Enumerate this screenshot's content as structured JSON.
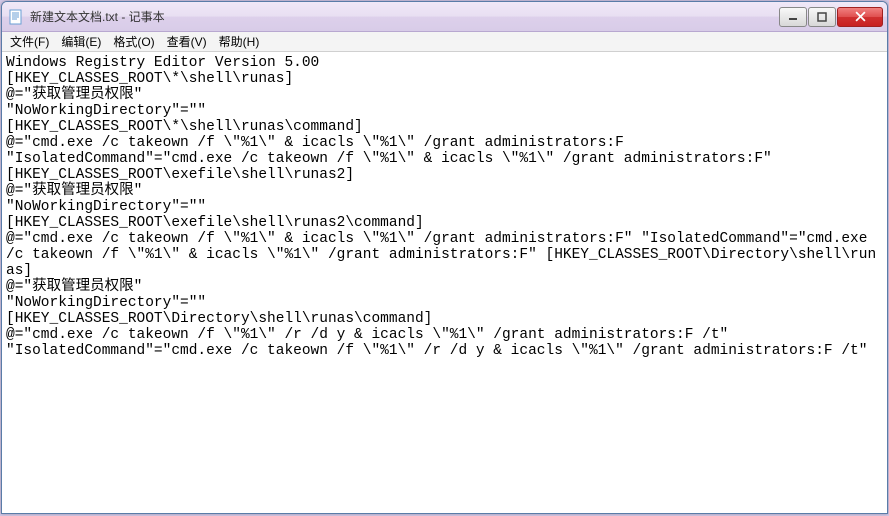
{
  "window": {
    "title": "新建文本文档.txt - 记事本"
  },
  "menu": {
    "file": "文件(F)",
    "edit": "编辑(E)",
    "format": "格式(O)",
    "view": "查看(V)",
    "help": "帮助(H)"
  },
  "content": "Windows Registry Editor Version 5.00\n[HKEY_CLASSES_ROOT\\*\\shell\\runas]\n@=\"获取管理员权限\"\n\"NoWorkingDirectory\"=\"\"\n[HKEY_CLASSES_ROOT\\*\\shell\\runas\\command]\n@=\"cmd.exe /c takeown /f \\\"%1\\\" & icacls \\\"%1\\\" /grant administrators:F\n\"IsolatedCommand\"=\"cmd.exe /c takeown /f \\\"%1\\\" & icacls \\\"%1\\\" /grant administrators:F\"\n[HKEY_CLASSES_ROOT\\exefile\\shell\\runas2]\n@=\"获取管理员权限\"\n\"NoWorkingDirectory\"=\"\"\n[HKEY_CLASSES_ROOT\\exefile\\shell\\runas2\\command]\n@=\"cmd.exe /c takeown /f \\\"%1\\\" & icacls \\\"%1\\\" /grant administrators:F\" \"IsolatedCommand\"=\"cmd.exe /c takeown /f \\\"%1\\\" & icacls \\\"%1\\\" /grant administrators:F\" [HKEY_CLASSES_ROOT\\Directory\\shell\\runas]\n@=\"获取管理员权限\"\n\"NoWorkingDirectory\"=\"\"\n[HKEY_CLASSES_ROOT\\Directory\\shell\\runas\\command]\n@=\"cmd.exe /c takeown /f \\\"%1\\\" /r /d y & icacls \\\"%1\\\" /grant administrators:F /t\"\n\"IsolatedCommand\"=\"cmd.exe /c takeown /f \\\"%1\\\" /r /d y & icacls \\\"%1\\\" /grant administrators:F /t\""
}
